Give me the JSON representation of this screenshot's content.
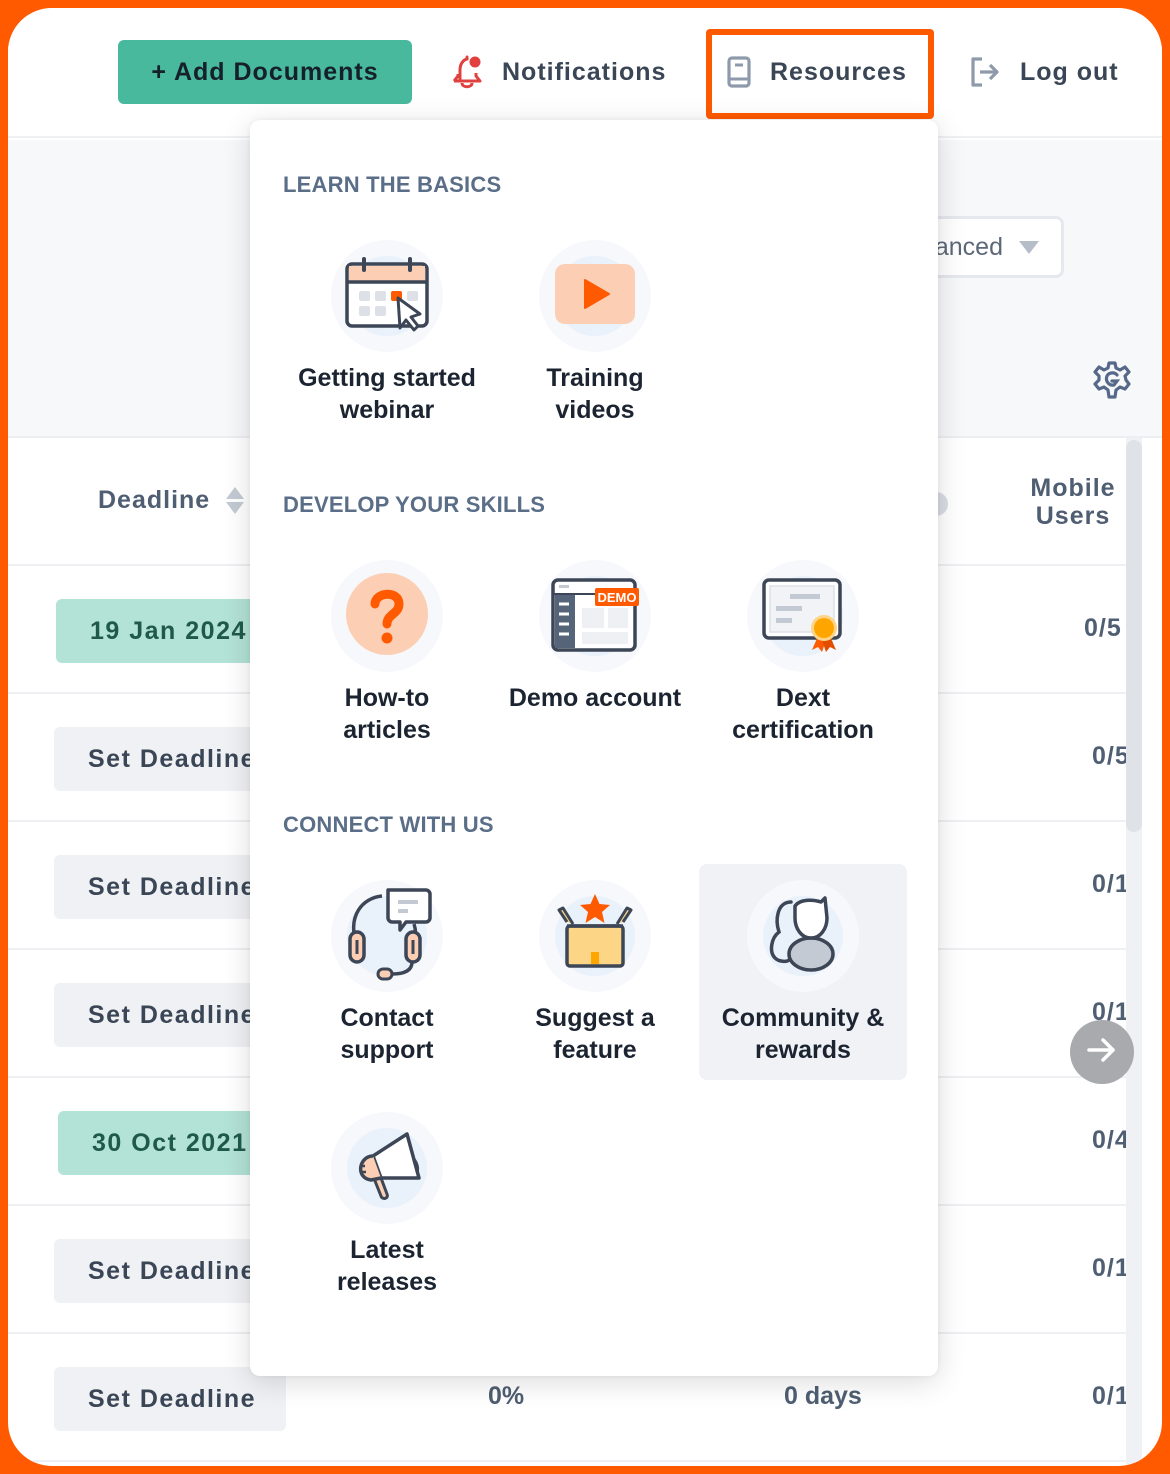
{
  "header": {
    "add_documents": "+ Add Documents",
    "notifications": "Notifications",
    "resources": "Resources",
    "logout": "Log out"
  },
  "toolbar": {
    "view_select_value": "anced",
    "settings_icon": "settings-gear-icon"
  },
  "table": {
    "columns": {
      "deadline": "Deadline",
      "mobile_users": "Mobile\nUsers"
    },
    "rows": [
      {
        "deadline": "19 Jan 2024",
        "deadline_type": "date",
        "mobile_users": "0/5"
      },
      {
        "deadline": "Set Deadline",
        "deadline_type": "set",
        "mobile_users": "0/5"
      },
      {
        "deadline": "Set Deadline",
        "deadline_type": "set",
        "mobile_users": "0/1"
      },
      {
        "deadline": "Set Deadline",
        "deadline_type": "set",
        "mobile_users": "0/1"
      },
      {
        "deadline": "30 Oct 2021",
        "deadline_type": "date",
        "mobile_users": "0/4"
      },
      {
        "deadline": "Set Deadline",
        "deadline_type": "set",
        "mobile_users": "0/1"
      },
      {
        "deadline": "Set Deadline",
        "deadline_type": "set",
        "mobile_users": "0/1",
        "percent": "0%",
        "days": "0 days"
      }
    ]
  },
  "resources_menu": {
    "sections": [
      {
        "title": "LEARN THE BASICS",
        "items": [
          {
            "label": "Getting started\nwebinar",
            "icon": "calendar-cursor-icon"
          },
          {
            "label": "Training\nvideos",
            "icon": "play-video-icon"
          }
        ]
      },
      {
        "title": "DEVELOP YOUR SKILLS",
        "items": [
          {
            "label": "How-to\narticles",
            "icon": "question-mark-icon"
          },
          {
            "label": "Demo account",
            "icon": "demo-browser-icon",
            "badge": "DEMO"
          },
          {
            "label": "Dext\ncertification",
            "icon": "certificate-icon"
          }
        ]
      },
      {
        "title": "CONNECT WITH US",
        "items": [
          {
            "label": "Contact\nsupport",
            "icon": "headset-chat-icon"
          },
          {
            "label": "Suggest a\nfeature",
            "icon": "box-star-icon"
          },
          {
            "label": "Community &\nrewards",
            "icon": "community-users-icon",
            "hovered": true
          },
          {
            "label": "Latest\nreleases",
            "icon": "megaphone-icon"
          }
        ]
      }
    ]
  },
  "colors": {
    "accent_orange": "#ff5a00",
    "primary_green": "#48b99c",
    "date_pill_bg": "#b3e2d6",
    "notification_red": "#e0403f"
  }
}
